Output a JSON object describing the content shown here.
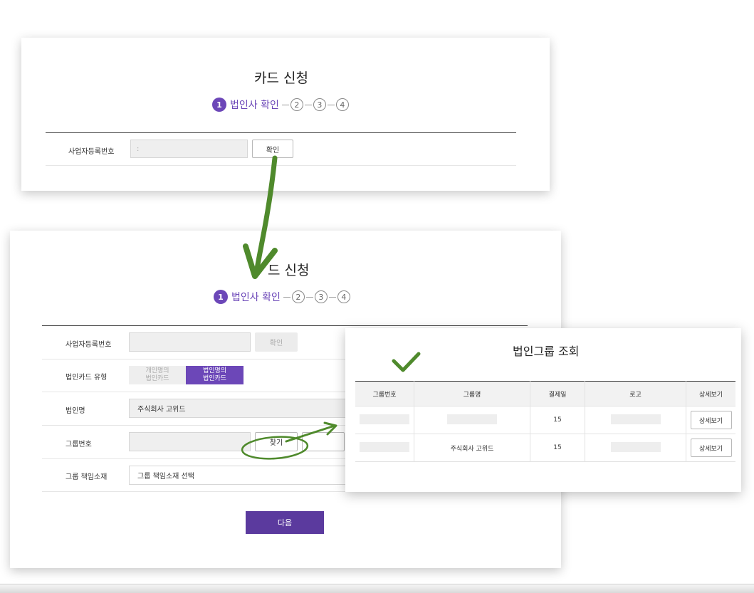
{
  "panel1": {
    "title": "카드 신청",
    "steps": {
      "active_num": "1",
      "active_label": "법인사 확인",
      "others": [
        "2",
        "3",
        "4"
      ]
    },
    "biz_reg_label": "사업자등록번호",
    "biz_reg_value": ":",
    "confirm_button": "확인"
  },
  "panel2": {
    "title": "카드 신청",
    "title_visible": "드 신청",
    "steps": {
      "active_num": "1",
      "active_label": "법인사 확인",
      "others": [
        "2",
        "3",
        "4"
      ]
    },
    "biz_reg_label": "사업자등록번호",
    "confirm_button": "확인",
    "card_type_label": "법인카드 유형",
    "card_type_personal": "개인명의\n법인카드",
    "card_type_corp": "법인명의\n법인카드",
    "corp_name_label": "법인명",
    "corp_name_value": "주식회사 고위드",
    "group_no_label": "그룹번호",
    "find_button": "찾기",
    "group_resp_label": "그룹 책임소재",
    "group_resp_value": "그룹 책임소재 선택",
    "next_button": "다음"
  },
  "panel3": {
    "title": "법인그룹 조회",
    "columns": [
      "그룹번호",
      "그룹명",
      "결제일",
      "로고",
      "상세보기"
    ],
    "rows": [
      {
        "group_no": "",
        "group_name": "",
        "pay_day": "15",
        "logo": "",
        "detail": "상세보기"
      },
      {
        "group_no": "",
        "group_name": "주식회사 고위드",
        "pay_day": "15",
        "logo": "",
        "detail": "상세보기"
      }
    ]
  },
  "colors": {
    "accent": "#6c47b8",
    "button_primary": "#5b3a9e",
    "annotation_green": "#4f8a2c"
  },
  "icons": [
    "down-arrow-annotation",
    "check-mark-annotation",
    "circle-annotation",
    "right-arrow-annotation"
  ]
}
